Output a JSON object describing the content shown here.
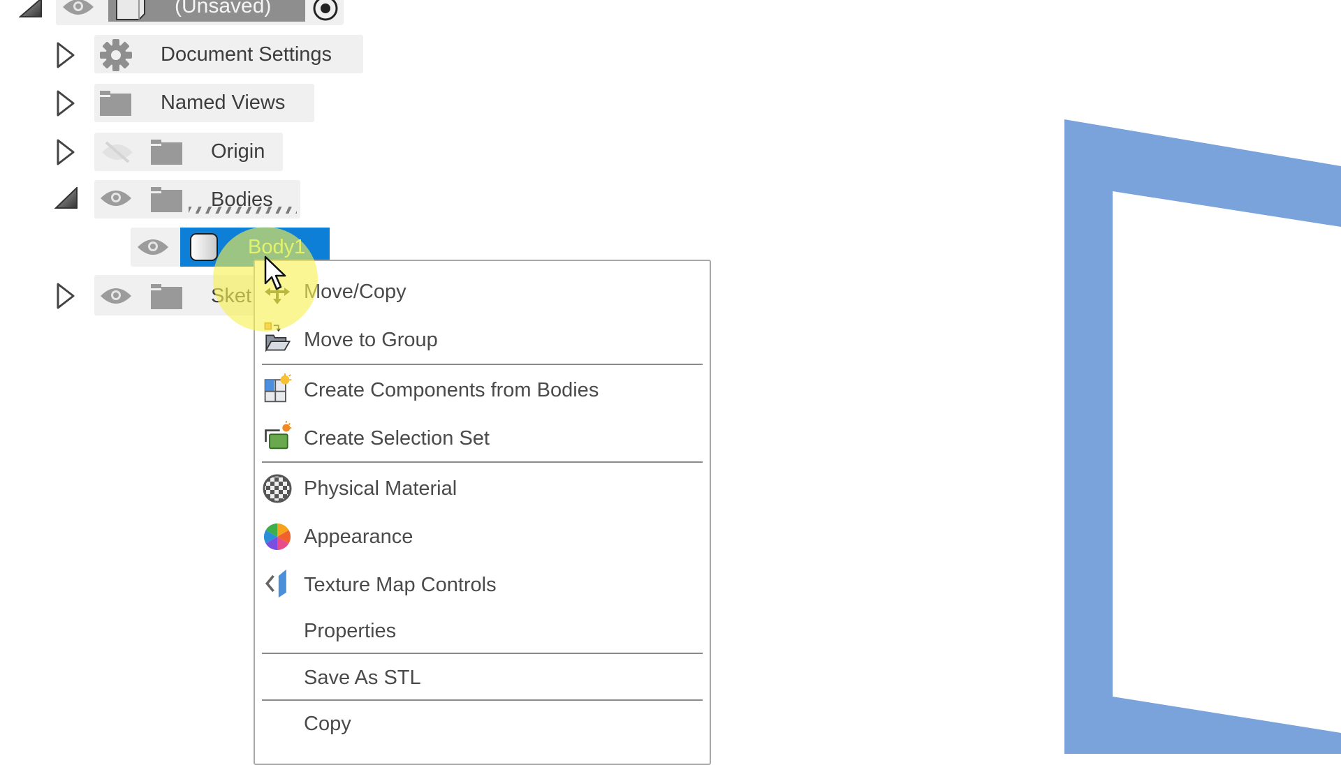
{
  "browser": {
    "root": {
      "label": "(Unsaved)",
      "expanded": true
    },
    "items": [
      {
        "label": "Document Settings",
        "icon": "gear-icon",
        "expanded": false
      },
      {
        "label": "Named Views",
        "icon": "folder-icon",
        "expanded": false
      },
      {
        "label": "Origin",
        "icon": "folder-icon",
        "visible": false,
        "expanded": false
      },
      {
        "label": "Bodies",
        "icon": "folder-icon",
        "visible": true,
        "expanded": true,
        "children": [
          {
            "label": "Body1",
            "icon": "body-icon",
            "visible": true,
            "selected": true
          }
        ]
      },
      {
        "label": "Sket",
        "icon": "folder-icon",
        "visible": true,
        "expanded": false
      }
    ]
  },
  "context_menu": {
    "items": [
      {
        "label": "Move/Copy",
        "icon": "move-icon"
      },
      {
        "label": "Move to Group",
        "icon": "move-to-group-icon"
      },
      {
        "label": "Create Components from Bodies",
        "icon": "create-components-icon"
      },
      {
        "label": "Create Selection Set",
        "icon": "selection-set-icon"
      },
      {
        "label": "Physical Material",
        "icon": "physical-material-icon"
      },
      {
        "label": "Appearance",
        "icon": "appearance-icon"
      },
      {
        "label": "Texture Map Controls",
        "icon": "texture-map-icon"
      },
      {
        "label": "Properties",
        "icon": null
      },
      {
        "label": "Save As STL",
        "icon": null
      },
      {
        "label": "Copy",
        "icon": null
      }
    ]
  },
  "colors": {
    "selection": "#0d7fd6",
    "selection_text": "#c9f29a",
    "model_edge": "#7aa3dc",
    "cursor_highlight": "#f5f050"
  }
}
